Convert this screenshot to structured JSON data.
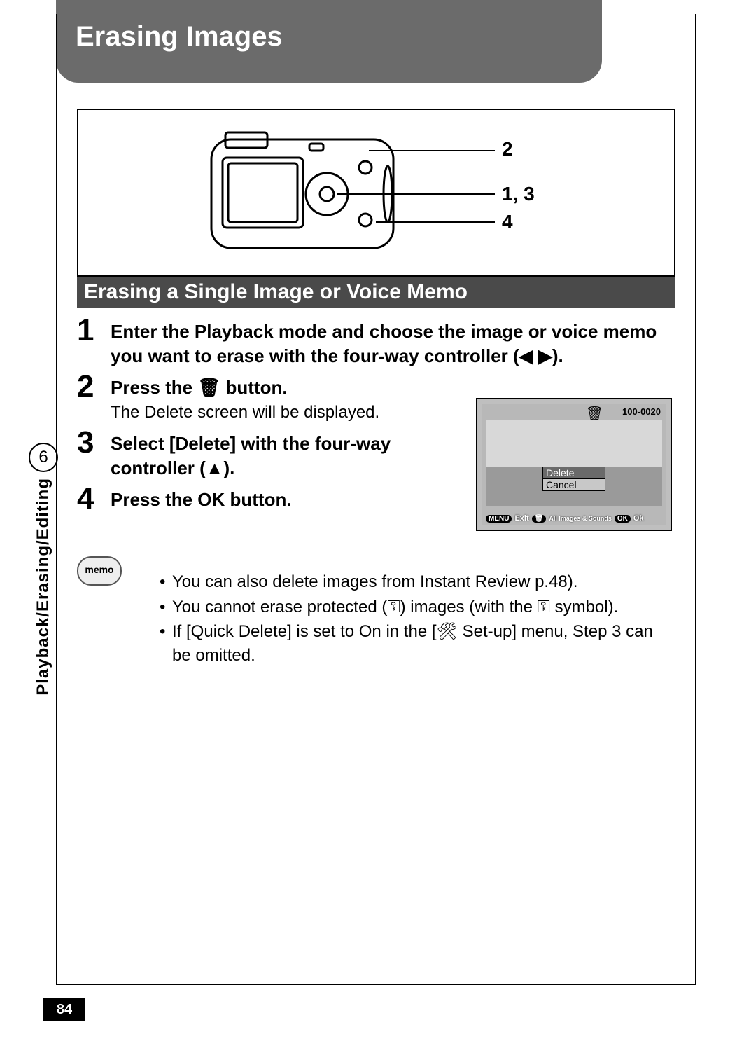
{
  "title": "Erasing Images",
  "section_title": "Erasing a Single Image or Voice Memo",
  "diagram_callouts": {
    "c1": "2",
    "c2": "1, 3",
    "c3": "4"
  },
  "steps": [
    {
      "num": "1",
      "bold": "Enter the Playback mode and choose the image or voice memo you want to erase with the four-way controller (◀ ▶).",
      "plain": ""
    },
    {
      "num": "2",
      "bold": "Press the 🗑 button.",
      "plain": "The Delete screen will be displayed."
    },
    {
      "num": "3",
      "bold": "Select [Delete] with the four-way controller (▲).",
      "plain": ""
    },
    {
      "num": "4",
      "bold": "Press the OK button.",
      "plain": ""
    }
  ],
  "lcd": {
    "file_number": "100-0020",
    "menu_selected": "Delete",
    "menu_other": "Cancel",
    "bottom": {
      "menu_pill": "MENU",
      "menu_action": "Exit",
      "trash_action": "All Images & Sounds",
      "ok_pill": "OK",
      "ok_action": "Ok"
    }
  },
  "side": {
    "chapter_num": "6",
    "chapter_label": "Playback/Erasing/Editing"
  },
  "memo_label": "memo",
  "memo_items": [
    "You can also delete images from Instant Review p.48).",
    "You cannot erase protected (⚿) images (with the ⚿ symbol).",
    "If [Quick Delete] is set to On in the [🛠 Set-up] menu, Step 3 can be omitted."
  ],
  "page_number": "84"
}
